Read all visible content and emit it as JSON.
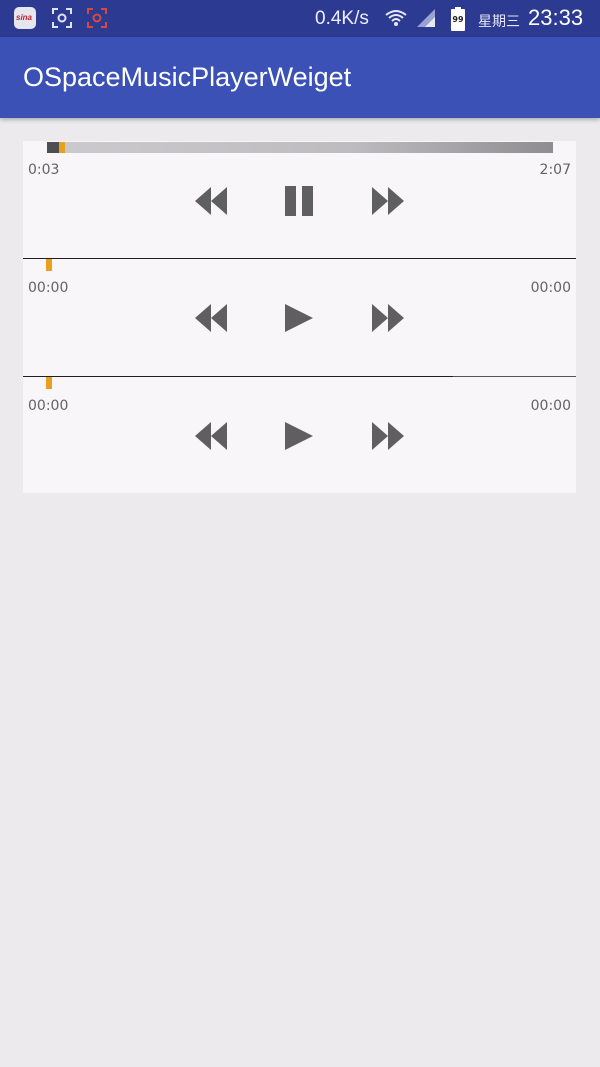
{
  "status_bar": {
    "net_speed": "0.4K/s",
    "battery_level": "99",
    "weekday": "星期三",
    "time": "23:33",
    "icons": [
      "sina-weibo-icon",
      "scan-icon",
      "scan-icon",
      "wifi-icon",
      "signal-icon",
      "battery-icon"
    ]
  },
  "app_bar": {
    "title": "OSpaceMusicPlayerWeiget"
  },
  "colors": {
    "app_bar": "#3b51b6",
    "status_bar": "#2c3a91",
    "accent": "#e8a01f",
    "control": "#5f5f62",
    "background": "#eceaec",
    "card": "#f8f6f9"
  },
  "players": [
    {
      "current_time": "0:03",
      "total_time": "2:07",
      "progress": 0.024,
      "state": "playing",
      "controls": [
        "rewind-icon",
        "pause-icon",
        "fast-forward-icon"
      ]
    },
    {
      "current_time": "00:00",
      "total_time": "00:00",
      "progress": 0,
      "state": "paused",
      "controls": [
        "rewind-icon",
        "play-icon",
        "fast-forward-icon"
      ]
    },
    {
      "current_time": "00:00",
      "total_time": "00:00",
      "progress": 0,
      "state": "paused",
      "controls": [
        "rewind-icon",
        "play-icon",
        "fast-forward-icon"
      ]
    }
  ]
}
